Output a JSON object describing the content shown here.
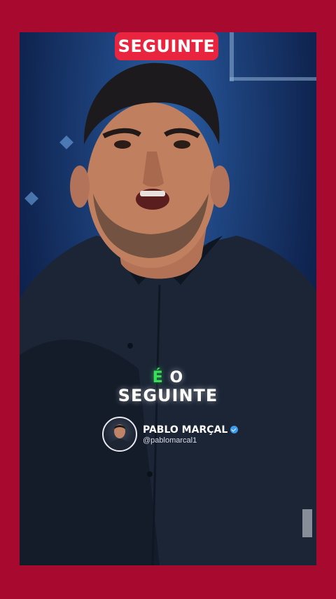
{
  "channel": {
    "badge_label": "SEGUINTE"
  },
  "caption": {
    "accent_word": "É",
    "line1_rest": " O",
    "line2": "SEGUINTE"
  },
  "profile": {
    "name": "PABLO MARÇAL",
    "handle": "@pablomarcal1",
    "verified": true
  },
  "colors": {
    "frame": "#a70a2e",
    "badge": "#e8243f",
    "accent_green": "#39e05a",
    "verified_blue": "#3a9bf0"
  },
  "icons": [
    "verified-badge-icon"
  ]
}
